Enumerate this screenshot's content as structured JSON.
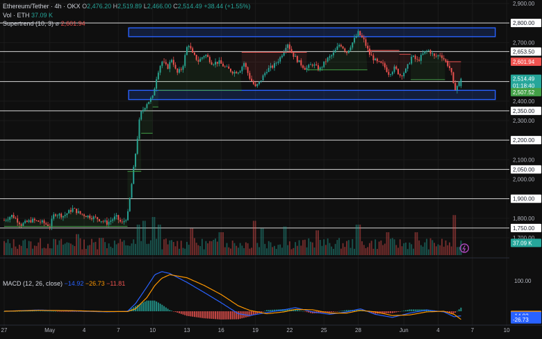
{
  "header": {
    "symbol": "Ethereum/Tether · 4h · OKX",
    "o_label": "O",
    "o": "2,476.20",
    "h_label": "H",
    "h": "2,519.89",
    "l_label": "L",
    "l": "2,466.00",
    "c_label": "C",
    "c": "2,514.49",
    "change": "+38.44 (+1.55%)",
    "vol_label": "Vol · ETH",
    "vol": "37.09 K",
    "st_label": "Supertrend (10, 3)",
    "st_symbol": "ø",
    "st_value": "2,601.94",
    "macd_label": "MACD (12, 26, close)",
    "macd": "−14.92",
    "signal": "−26.73",
    "hist": "−11.81"
  },
  "colors": {
    "background": "#0f0f0f",
    "up": "#26a69a",
    "down": "#ef5350",
    "box": "#2962ff",
    "level_line": "#d9d9d9",
    "macd_line": "#2962ff",
    "signal_line": "#ff9800",
    "supertrend_up": "#43a047",
    "supertrend_down": "#ef5350"
  },
  "chart_data": [
    {
      "type": "candlestick",
      "pair": "ETH/USDT",
      "interval": "4h",
      "exchange": "OKX",
      "ylim": [
        1650,
        2900
      ],
      "y_ticks": [
        1700,
        1800,
        1900,
        2000,
        2100,
        2200,
        2300,
        2400,
        2500,
        2600,
        2700,
        2800,
        2900
      ],
      "y_tick_labels": [
        "1,700.00",
        "1,800.00",
        "1,900.00",
        "2,000.00",
        "2,100.00",
        "2,200.00",
        "2,300.00",
        "2,400.00",
        "2,500.00",
        "2,600.00",
        "2,700.00",
        "2,800.00",
        "2,900.00"
      ],
      "x_ticks": [
        "27",
        "May",
        "4",
        "7",
        "10",
        "13",
        "16",
        "19",
        "22",
        "25",
        "28",
        "Jun",
        "4",
        "7",
        "10"
      ],
      "x_tick_days": [
        0,
        4,
        7,
        10,
        13,
        16,
        19,
        22,
        25,
        28,
        31,
        35,
        38,
        41,
        44
      ],
      "x_range_days": [
        0,
        44.6
      ],
      "horizontal_levels": [
        {
          "value": 2800,
          "label": "2,800.00"
        },
        {
          "value": 2653.5,
          "label": "2,653.50"
        },
        {
          "value": 2500,
          "label": "2,500.00"
        },
        {
          "value": 2350,
          "label": "2,350.00"
        },
        {
          "value": 2200,
          "label": "2,200.00"
        },
        {
          "value": 2050,
          "label": "2,050.00"
        },
        {
          "value": 1900,
          "label": "1,900.00"
        },
        {
          "value": 1750,
          "label": "1,750.00"
        }
      ],
      "zones": [
        {
          "from_day": 10.9,
          "to_day": 43.0,
          "low": 2730,
          "high": 2775
        },
        {
          "from_day": 10.9,
          "to_day": 43.0,
          "low": 2408,
          "high": 2455
        }
      ],
      "price_tags": [
        {
          "label": "2,601.94",
          "value": 2601.94,
          "color": "#ef5350"
        },
        {
          "label": "2,514.49",
          "value": 2514.49,
          "color": "#26a69a"
        },
        {
          "label": "01:18:40",
          "value": 2480,
          "color": "#26a69a"
        },
        {
          "label": "2,507.52",
          "value": 2446,
          "color": "#43a047"
        },
        {
          "label": "37.09 K",
          "value": 1674,
          "color": "#26a69a"
        }
      ],
      "price_keypoints": [
        [
          0,
          1790
        ],
        [
          0.7,
          1815
        ],
        [
          1.5,
          1768
        ],
        [
          2.4,
          1790
        ],
        [
          3.3,
          1780
        ],
        [
          4.0,
          1760
        ],
        [
          4.4,
          1825
        ],
        [
          5.2,
          1812
        ],
        [
          6.0,
          1848
        ],
        [
          6.7,
          1822
        ],
        [
          7.4,
          1810
        ],
        [
          8.2,
          1798
        ],
        [
          9.0,
          1775
        ],
        [
          9.8,
          1808
        ],
        [
          10.3,
          1772
        ],
        [
          10.8,
          1810
        ],
        [
          11.2,
          1990
        ],
        [
          11.6,
          2180
        ],
        [
          11.9,
          2330
        ],
        [
          12.2,
          2360
        ],
        [
          12.5,
          2390
        ],
        [
          13.0,
          2420
        ],
        [
          13.4,
          2540
        ],
        [
          13.8,
          2605
        ],
        [
          14.3,
          2570
        ],
        [
          14.7,
          2620
        ],
        [
          15.1,
          2540
        ],
        [
          15.6,
          2570
        ],
        [
          16.1,
          2700
        ],
        [
          16.5,
          2640
        ],
        [
          17.0,
          2605
        ],
        [
          17.6,
          2640
        ],
        [
          18.2,
          2595
        ],
        [
          18.8,
          2600
        ],
        [
          19.4,
          2570
        ],
        [
          20.1,
          2548
        ],
        [
          20.6,
          2555
        ],
        [
          21.0,
          2595
        ],
        [
          21.5,
          2520
        ],
        [
          22.0,
          2470
        ],
        [
          22.4,
          2500
        ],
        [
          23.0,
          2560
        ],
        [
          23.6,
          2580
        ],
        [
          24.2,
          2625
        ],
        [
          24.8,
          2700
        ],
        [
          25.2,
          2645
        ],
        [
          25.8,
          2600
        ],
        [
          26.4,
          2565
        ],
        [
          27.0,
          2590
        ],
        [
          27.6,
          2560
        ],
        [
          28.2,
          2610
        ],
        [
          28.8,
          2640
        ],
        [
          29.4,
          2695
        ],
        [
          30.0,
          2650
        ],
        [
          30.6,
          2710
        ],
        [
          31.0,
          2750
        ],
        [
          31.5,
          2710
        ],
        [
          32.0,
          2640
        ],
        [
          32.6,
          2600
        ],
        [
          33.2,
          2585
        ],
        [
          33.7,
          2540
        ],
        [
          34.2,
          2570
        ],
        [
          34.7,
          2530
        ],
        [
          35.2,
          2560
        ],
        [
          35.7,
          2630
        ],
        [
          36.2,
          2605
        ],
        [
          36.8,
          2650
        ],
        [
          37.2,
          2660
        ],
        [
          37.7,
          2625
        ],
        [
          38.2,
          2640
        ],
        [
          38.7,
          2600
        ],
        [
          39.1,
          2560
        ],
        [
          39.4,
          2460
        ],
        [
          39.7,
          2480
        ],
        [
          40.0,
          2514.49
        ]
      ],
      "supertrend": [
        {
          "from_day": 0,
          "to_day": 10.8,
          "value": 1758,
          "trend": "up"
        },
        {
          "from_day": 10.8,
          "to_day": 12.0,
          "value": 2040,
          "trend": "up"
        },
        {
          "from_day": 12.0,
          "to_day": 13.0,
          "value": 2235,
          "trend": "up"
        },
        {
          "from_day": 13.0,
          "to_day": 13.5,
          "value": 2370,
          "trend": "up"
        },
        {
          "from_day": 13.5,
          "to_day": 20.8,
          "value": 2455,
          "trend": "up"
        },
        {
          "from_day": 20.8,
          "to_day": 26.5,
          "value": 2650,
          "trend": "down"
        },
        {
          "from_day": 26.5,
          "to_day": 31.8,
          "value": 2560,
          "trend": "up"
        },
        {
          "from_day": 31.8,
          "to_day": 34.6,
          "value": 2660,
          "trend": "down"
        },
        {
          "from_day": 34.6,
          "to_day": 35.6,
          "value": 2640,
          "trend": "down"
        },
        {
          "from_day": 35.6,
          "to_day": 38.6,
          "value": 2510,
          "trend": "up"
        },
        {
          "from_day": 38.6,
          "to_day": 40.0,
          "value": 2601.94,
          "trend": "down"
        }
      ]
    },
    {
      "type": "bar",
      "name": "Vol · ETH",
      "last_value_label": "37.09 K",
      "spikes": [
        [
          6.4,
          0.55
        ],
        [
          8.5,
          0.45
        ],
        [
          11.7,
          0.8
        ],
        [
          12.3,
          0.9
        ],
        [
          13.1,
          1.0
        ],
        [
          13.6,
          0.8
        ],
        [
          16.4,
          0.7
        ],
        [
          19.0,
          0.6
        ],
        [
          21.9,
          0.9
        ],
        [
          22.6,
          0.7
        ],
        [
          24.6,
          0.75
        ],
        [
          27.4,
          0.65
        ],
        [
          31.0,
          0.8
        ],
        [
          33.6,
          0.6
        ],
        [
          36.1,
          0.6
        ],
        [
          39.4,
          1.05
        ]
      ]
    },
    {
      "type": "line",
      "name": "MACD (12, 26, close)",
      "ylim": [
        -30,
        150
      ],
      "y_ticks": [
        100
      ],
      "y_tick_labels": [
        "100.00"
      ],
      "series": [
        {
          "name": "MACD",
          "color": "#2962ff",
          "last": -14.92,
          "points": [
            [
              0,
              0
            ],
            [
              3,
              4
            ],
            [
              6,
              1
            ],
            [
              9,
              -2
            ],
            [
              10.8,
              0
            ],
            [
              11.5,
              25
            ],
            [
              12.5,
              80
            ],
            [
              13.2,
              120
            ],
            [
              13.8,
              130
            ],
            [
              14.5,
              124
            ],
            [
              16,
              95
            ],
            [
              17.5,
              62
            ],
            [
              19,
              28
            ],
            [
              20.5,
              -8
            ],
            [
              21.5,
              -14
            ],
            [
              23,
              -4
            ],
            [
              24.5,
              5
            ],
            [
              25.5,
              12
            ],
            [
              27,
              -2
            ],
            [
              28.5,
              -10
            ],
            [
              30,
              -2
            ],
            [
              31.2,
              8
            ],
            [
              32.5,
              -10
            ],
            [
              34,
              -20
            ],
            [
              35.5,
              -6
            ],
            [
              37,
              4
            ],
            [
              38.5,
              -2
            ],
            [
              39.4,
              -18
            ],
            [
              40,
              -14.92
            ]
          ]
        },
        {
          "name": "Signal",
          "color": "#ff9800",
          "last": -26.73,
          "points": [
            [
              0,
              0
            ],
            [
              3,
              3
            ],
            [
              6,
              2
            ],
            [
              9,
              -1
            ],
            [
              10.8,
              -1
            ],
            [
              11.5,
              8
            ],
            [
              12.5,
              45
            ],
            [
              13.2,
              85
            ],
            [
              13.8,
              108
            ],
            [
              14.5,
              120
            ],
            [
              16,
              110
            ],
            [
              17.5,
              85
            ],
            [
              19,
              55
            ],
            [
              20.5,
              18
            ],
            [
              21.5,
              3
            ],
            [
              23,
              -8
            ],
            [
              24.5,
              -2
            ],
            [
              25.5,
              6
            ],
            [
              27,
              5
            ],
            [
              28.5,
              -6
            ],
            [
              30,
              -6
            ],
            [
              31.2,
              3
            ],
            [
              32.5,
              -2
            ],
            [
              34,
              -14
            ],
            [
              35.5,
              -12
            ],
            [
              37,
              -2
            ],
            [
              38.5,
              0
            ],
            [
              39.4,
              -10
            ],
            [
              40,
              -26.73
            ]
          ]
        }
      ],
      "histogram_last": -11.81,
      "price_tags": [
        {
          "label": "-11.81",
          "value": -11.81,
          "color": "#ff9800"
        },
        {
          "label": "-14.92",
          "value": -14.92,
          "color": "#2962ff"
        },
        {
          "label": "-26.73",
          "value": -26.73,
          "color": "#2962ff"
        }
      ]
    }
  ]
}
